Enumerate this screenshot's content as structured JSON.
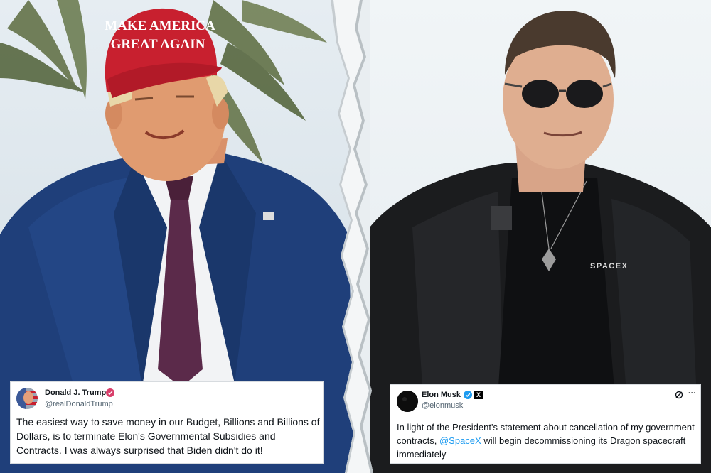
{
  "trump_photo": {
    "hat_line1": "MAKE AMERICA",
    "hat_line2": "GREAT AGAIN"
  },
  "musk_photo": {
    "shirt_logo": "SPACEX"
  },
  "trump_post": {
    "name": "Donald J. Trump",
    "handle": "@realDonaldTrump",
    "text": "The easiest way to save money in our Budget, Billions and Billions of Dollars, is to terminate Elon's Governmental Subsidies and Contracts. I was always surprised that Biden didn't do it!",
    "verified_badge_color": "#d93f6b",
    "badge_icon": "verified-badge-icon"
  },
  "musk_post": {
    "name": "Elon Musk",
    "handle": "@elonmusk",
    "text_before": "In light of the President's statement about cancellation of my government contracts, ",
    "mention": "@SpaceX",
    "text_after": " will begin decommissioning its Dragon spacecraft immediately",
    "verified_badge_color": "#1d9bf0",
    "affiliate_badge": "X",
    "icons": [
      "verified-badge-icon",
      "x-affiliate-icon",
      "grok-icon",
      "more-icon"
    ],
    "more_label": "···"
  },
  "colors": {
    "suit": "#1f3f7a",
    "tie": "#5b2a4a",
    "hat": "#c8202f",
    "jacket": "#1b1c1e",
    "mention": "#1d9bf0"
  }
}
